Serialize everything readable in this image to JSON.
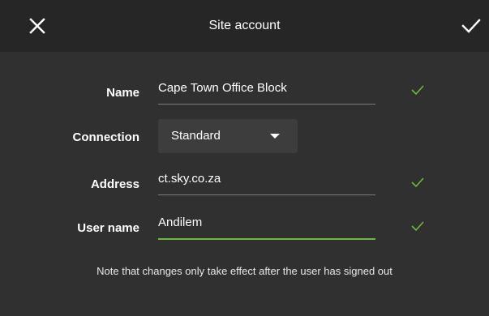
{
  "header": {
    "title": "Site account",
    "close_icon": "close-icon",
    "confirm_icon": "check-icon"
  },
  "form": {
    "name": {
      "label": "Name",
      "value": "Cape Town Office Block",
      "valid": true
    },
    "connection": {
      "label": "Connection",
      "selected": "Standard"
    },
    "address": {
      "label": "Address",
      "value": "ct.sky.co.za",
      "valid": true
    },
    "username": {
      "label": "User name",
      "value": "Andilem",
      "valid": true
    }
  },
  "note": "Note that changes only take effect after the user has signed out",
  "colors": {
    "background": "#303030",
    "header": "#262626",
    "accent": "#6dba3c",
    "dropdown": "#3d3d3d"
  }
}
